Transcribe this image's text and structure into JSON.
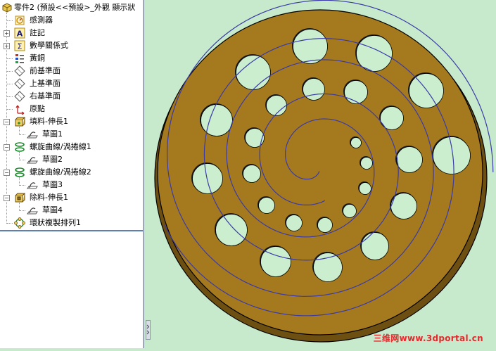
{
  "feature_tree": {
    "root_label": "零件2 (預設<<預設>_外觀 顯示狀",
    "items": [
      {
        "label": "感測器",
        "icon": "sensor-icon"
      },
      {
        "label": "註記",
        "icon": "annotation-icon"
      },
      {
        "label": "數學關係式",
        "icon": "equation-icon"
      },
      {
        "label": "黃銅",
        "icon": "material-icon"
      },
      {
        "label": "前基準面",
        "icon": "plane-icon"
      },
      {
        "label": "上基準面",
        "icon": "plane-icon"
      },
      {
        "label": "右基準面",
        "icon": "plane-icon"
      },
      {
        "label": "原點",
        "icon": "origin-icon"
      },
      {
        "label": "填料-伸長1",
        "icon": "boss-extrude-icon"
      },
      {
        "label": "草圖1",
        "icon": "sketch-icon"
      },
      {
        "label": "螺旋曲線/渦捲線1",
        "icon": "helix-icon"
      },
      {
        "label": "草圖2",
        "icon": "sketch-icon"
      },
      {
        "label": "螺旋曲線/渦捲線2",
        "icon": "helix-icon"
      },
      {
        "label": "草圖3",
        "icon": "sketch-icon"
      },
      {
        "label": "除料-伸長1",
        "icon": "cut-extrude-icon"
      },
      {
        "label": "草圖4",
        "icon": "sketch-icon"
      },
      {
        "label": "環狀複製排列1",
        "icon": "circular-pattern-icon"
      }
    ]
  },
  "viewport": {
    "background_color": "#c8eacc",
    "disc_color": "#a57a1f",
    "curve_color": "#3a3aa8",
    "hole_color": "#cbeecf"
  },
  "watermark": "三维网www.3dportal.cn"
}
